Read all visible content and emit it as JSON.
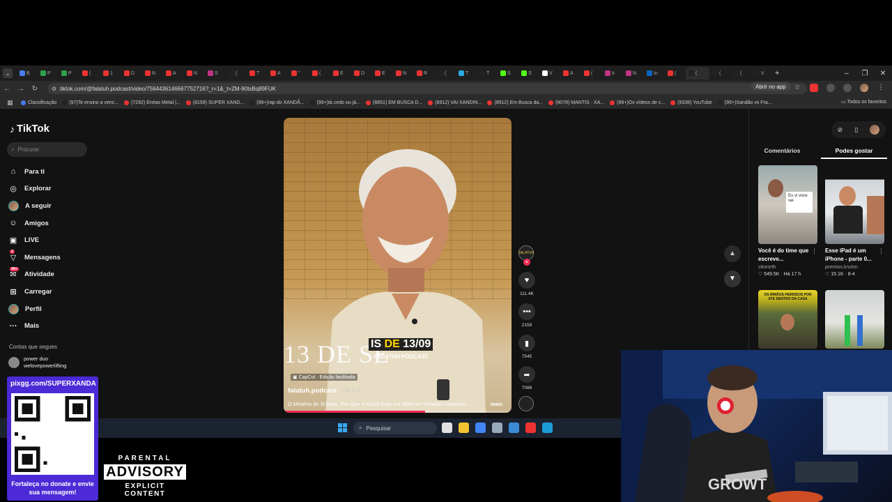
{
  "browser": {
    "tabs": [
      {
        "letter": "B",
        "color": "#4a7cf0"
      },
      {
        "letter": "P",
        "color": "#2da24a"
      },
      {
        "letter": "P",
        "color": "#2da24a"
      },
      {
        "letter": "(",
        "color": "#e33"
      },
      {
        "letter": "1",
        "color": "#e33"
      },
      {
        "letter": "D",
        "color": "#e33"
      },
      {
        "letter": "N",
        "color": "#e33"
      },
      {
        "letter": "A",
        "color": "#e33"
      },
      {
        "letter": "N",
        "color": "#e33"
      },
      {
        "letter": "S",
        "color": "#c13584"
      },
      {
        "letter": "(",
        "color": "#222"
      },
      {
        "letter": "T",
        "color": "#e33"
      },
      {
        "letter": "A",
        "color": "#e33"
      },
      {
        "letter": "\"",
        "color": "#e33"
      },
      {
        "letter": "(",
        "color": "#e33"
      },
      {
        "letter": "E",
        "color": "#e33"
      },
      {
        "letter": "D",
        "color": "#e33"
      },
      {
        "letter": "E",
        "color": "#e33"
      },
      {
        "letter": "N",
        "color": "#e33"
      },
      {
        "letter": "R",
        "color": "#e33"
      },
      {
        "letter": "(",
        "color": "#222"
      },
      {
        "letter": "T",
        "color": "#29a9e0"
      },
      {
        "letter": "T",
        "color": "#222"
      },
      {
        "letter": "S",
        "color": "#53fc18"
      },
      {
        "letter": "S",
        "color": "#53fc18"
      },
      {
        "letter": "V",
        "color": "#fff"
      },
      {
        "letter": "A",
        "color": "#e33"
      },
      {
        "letter": "(",
        "color": "#e33"
      },
      {
        "letter": "Ir",
        "color": "#c13584"
      },
      {
        "letter": "N",
        "color": "#c13584"
      },
      {
        "letter": "In",
        "color": "#0a66c2"
      },
      {
        "letter": "(",
        "color": "#e33"
      },
      {
        "letter": "(",
        "color": "#222"
      },
      {
        "letter": "(",
        "color": "#222"
      },
      {
        "letter": "(",
        "color": "#222"
      },
      {
        "letter": "V",
        "color": "#222"
      }
    ],
    "active_tab_letter": "N",
    "last_tab_letter": "In",
    "new_tab": "+",
    "window_controls": [
      "–",
      "❐",
      "✕"
    ],
    "url": "tiktok.com/@falatuh.podcast/video/7564436146667752716?_r=1&_t=ZM-90tsBq89FUK",
    "open_in_app": "Abrir no app",
    "bookmarks": [
      "Classificação",
      "(97)Te ensino a venc...",
      "(7292) Enéas Metal |...",
      "(8159) SUPER XAND...",
      "(99+)rap do XANDÃ...",
      "(99+)tá cedo ou já...",
      "(8851) EM BUSCA D...",
      "(8912) VAI XANDIN...",
      "(8912) Em Busca da...",
      "(9078) MANTIS · XA...",
      "(99+)Os vídeos de c...",
      "(9338) YouTube",
      "(99+)Xandão vs Fra..."
    ],
    "all_favorites": "Todos os favoritos"
  },
  "tiktok": {
    "logo": "TikTok",
    "search_placeholder": "Procurar",
    "menu": [
      {
        "icon": "⌂",
        "label": "Para ti",
        "badge": ""
      },
      {
        "icon": "◎",
        "label": "Explorar",
        "badge": ""
      },
      {
        "icon": "avatar",
        "label": "A seguir",
        "badge": ""
      },
      {
        "icon": "☺",
        "label": "Amigos",
        "badge": ""
      },
      {
        "icon": "▣",
        "label": "LIVE",
        "badge": ""
      },
      {
        "icon": "▽",
        "label": "Mensagens",
        "badge": "2"
      },
      {
        "icon": "✉",
        "label": "Atividade",
        "badge": "99+"
      },
      {
        "icon": "⊞",
        "label": "Carregar",
        "badge": ""
      },
      {
        "icon": "avatar",
        "label": "Perfil",
        "badge": ""
      },
      {
        "icon": "···",
        "label": "Mais",
        "badge": ""
      }
    ],
    "following_heading": "Contas que segues",
    "following_account": {
      "name": "power duo",
      "handle": "welovepowerlifting"
    },
    "video": {
      "big_caption": "13 DE SE",
      "date_tag_pre": "IS ",
      "date_tag_hl": "DE",
      "date_tag_post": " 13/09",
      "brand": "FALATUH PODCAST",
      "capcut": "CapCut · Edição facilitada",
      "username": "falatuh.podcast",
      "age": "· Há 4 d",
      "description": "O Mistério do 3I Atlas: Por Que a NASA Está em Silêncio? #3Iatlas #misterio ...",
      "more": "mais",
      "progress": 0.62
    },
    "actions": {
      "creator_label": "FALATUH",
      "likes": "111.4K",
      "comments": "2159",
      "saves": "7545",
      "shares": "7086"
    },
    "right_tabs": [
      "Comentários",
      "Podes gostar"
    ],
    "cards": [
      {
        "title": "Você é do time que escreve...",
        "author": "vitororth",
        "likes": "549.5K",
        "time": "Há 17 h"
      },
      {
        "title": "Esse iPad é um iPhone - parte 0...",
        "author": "premios.knzinn",
        "likes": "15.1K",
        "time": "8-4"
      },
      {
        "title": "",
        "author": "",
        "likes": "",
        "time": "",
        "thumb_text": "OS IRMÃOS PERDIDOS POR ATE DENTRO DA CASA"
      },
      {
        "title": "",
        "author": "",
        "likes": "",
        "time": ""
      }
    ],
    "card_sign": "Eu vi voce vai"
  },
  "taskbar": {
    "search_placeholder": "Pesquisar",
    "apps": [
      "#e0e0e0",
      "#f4c430",
      "#4285f4",
      "#9ab",
      "#3b8bd9",
      "#e33",
      "#1b9cd6"
    ]
  },
  "overlays": {
    "pix_url": "pixgg.com/SUPERXANDA",
    "pix_message": "Fortaleça no donate e envie sua mensagem!",
    "advisory_top": "PARENTAL",
    "advisory_mid": "ADVISORY",
    "advisory_bottom": "EXPLICIT CONTENT",
    "webcam_shirt": "GROWT"
  }
}
